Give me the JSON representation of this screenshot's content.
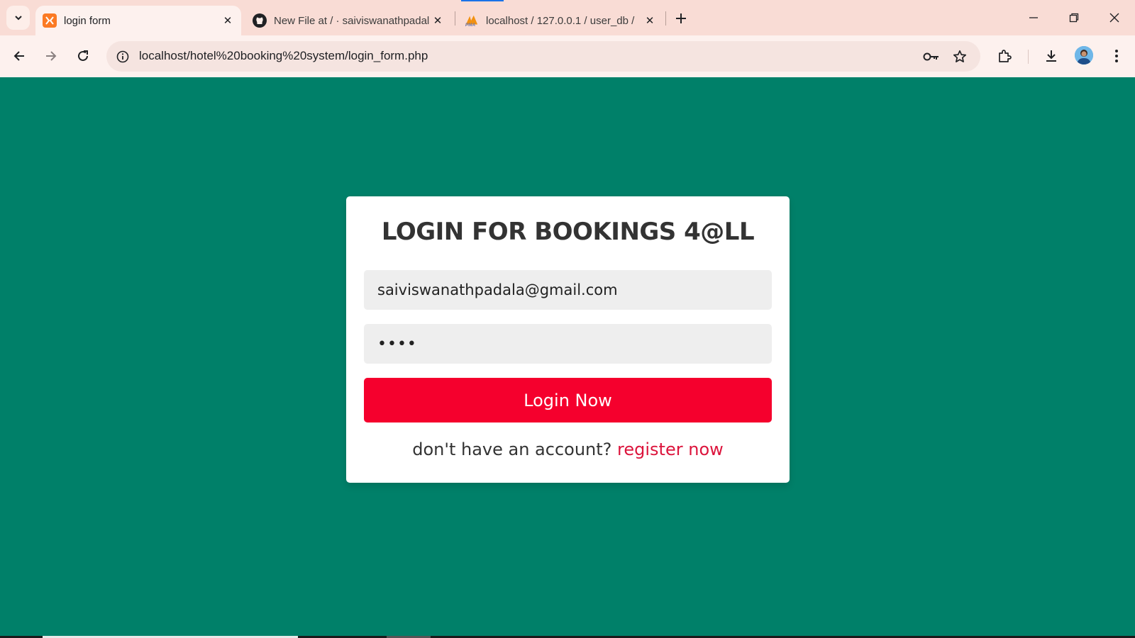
{
  "browser": {
    "tabs": [
      {
        "title": "login form",
        "favicon": "xampp-icon",
        "active": true
      },
      {
        "title": "New File at / · saiviswanathpadala",
        "favicon": "github-icon",
        "active": false
      },
      {
        "title": "localhost / 127.0.0.1 / user_db / ",
        "favicon": "phpmyadmin-icon",
        "active": false
      }
    ],
    "url": "localhost/hotel%20booking%20system/login_form.php",
    "colors": {
      "tabstrip": "#f9dcd5",
      "toolbar": "#fdf1ee"
    }
  },
  "page": {
    "background": "#008069",
    "title": "LOGIN FOR BOOKINGS 4@LL",
    "email_value": "saiviswanathpadala@gmail.com",
    "password_value": "abcd",
    "login_button": "Login Now",
    "register_prompt": "don't have an account?",
    "register_link": "register now",
    "accent": "#f5002d",
    "link_color": "#dc143c"
  }
}
